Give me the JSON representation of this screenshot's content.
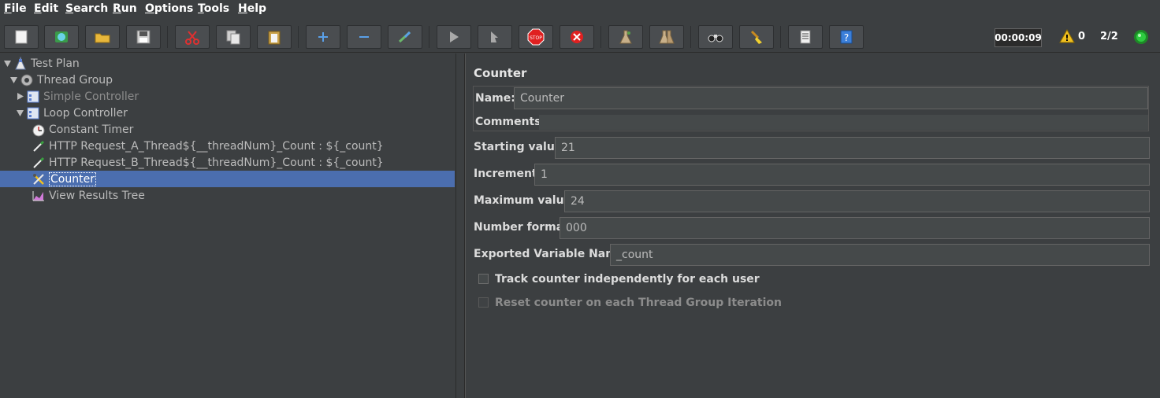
{
  "menu": {
    "items": [
      {
        "mnemonic": "F",
        "rest": "ile"
      },
      {
        "mnemonic": "E",
        "rest": "dit"
      },
      {
        "mnemonic": "S",
        "rest": "earch"
      },
      {
        "mnemonic": "R",
        "rest": "un"
      },
      {
        "mnemonic": "O",
        "rest": "ptions"
      },
      {
        "mnemonic": "T",
        "rest": "ools"
      },
      {
        "mnemonic": "H",
        "rest": "elp"
      }
    ]
  },
  "toolbar": {
    "buttons": [
      "new-icon",
      "templates-icon",
      "open-icon",
      "save-icon",
      "cut-icon",
      "copy-icon",
      "paste-icon",
      "expand-icon",
      "collapse-icon",
      "toggle-icon",
      "start-icon",
      "start-no-pause-icon",
      "stop-icon",
      "shutdown-icon",
      "clear-icon",
      "clear-all-icon",
      "search-icon",
      "reset-search-icon",
      "function-helper-icon",
      "help-icon"
    ],
    "timer": "00:00:09",
    "warnings": "0",
    "threads": "2/2",
    "status_color": "#2ecc40"
  },
  "tree": {
    "nodes": [
      {
        "label": "Test Plan",
        "icon": "test-plan-icon",
        "expanded": true
      },
      {
        "label": "Thread Group",
        "icon": "gear-icon",
        "expanded": true
      },
      {
        "label": "Simple Controller",
        "icon": "controller-icon",
        "expanded": false,
        "disabled": true
      },
      {
        "label": "Loop Controller",
        "icon": "controller-icon",
        "expanded": true
      },
      {
        "label": "Constant Timer",
        "icon": "timer-icon"
      },
      {
        "label": "HTTP Request_A_Thread${__threadNum}_Count : ${_count}",
        "icon": "pipette-icon"
      },
      {
        "label": "HTTP Request_B_Thread${__threadNum}_Count : ${_count}",
        "icon": "pipette-icon"
      },
      {
        "label": "Counter",
        "icon": "counter-icon",
        "selected": true
      },
      {
        "label": "View Results Tree",
        "icon": "results-icon"
      }
    ]
  },
  "panel": {
    "title": "Counter",
    "name_label": "Name:",
    "name_value": "Counter",
    "comments_label": "Comments:",
    "starting_label": "Starting value",
    "starting_value": "21",
    "increment_label": "Increment",
    "increment_value": "1",
    "maximum_label": "Maximum value",
    "maximum_value": "24",
    "format_label": "Number format",
    "format_value": "000",
    "exported_label": "Exported Variable Name",
    "exported_value": "_count",
    "track_label": "Track counter independently for each user",
    "reset_label": "Reset counter on each Thread Group Iteration"
  },
  "colors": {
    "selection": "#4b6eaf",
    "background": "#3c3f41"
  }
}
